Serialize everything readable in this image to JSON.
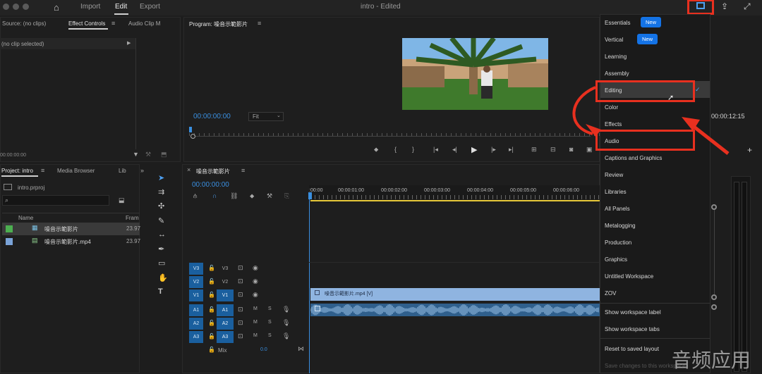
{
  "app": {
    "nav": {
      "import": "Import",
      "edit": "Edit",
      "export": "Export"
    },
    "title": "intro - Edited"
  },
  "source_panel": {
    "tabs": [
      "Source: (no clips)",
      "Effect Controls",
      "Audio Clip M"
    ],
    "no_clip": "(no clip selected)",
    "timecode": "00:00:00:00"
  },
  "program": {
    "title": "Program: 噪音示範影片",
    "timecode": "00:00:00:00",
    "fit": "Fit",
    "end_timecode": "00:00:12:15"
  },
  "project": {
    "tabs": [
      "Project: intro",
      "Media Browser",
      "Lib"
    ],
    "file": "intro.prproj",
    "columns": {
      "name": "Name",
      "frame": "Fram"
    },
    "items": [
      {
        "name": "噪音示範影片",
        "fps": "23.97",
        "color": "#4caf50"
      },
      {
        "name": "噪音示範影片.mp4",
        "fps": "23.97",
        "color": "#7aa3d8"
      }
    ]
  },
  "timeline": {
    "sequence_name": "噪音示範影片",
    "timecode": "00:00:00:00",
    "ruler": [
      ":00:00",
      "00:00:01:00",
      "00:00:02:00",
      "00:00:03:00",
      "00:00:04:00",
      "00:00:05:00",
      "00:00:06:00"
    ],
    "video_tracks": [
      {
        "patch": "V3",
        "name": "V3"
      },
      {
        "patch": "V2",
        "name": "V2"
      },
      {
        "patch": "V1",
        "name": "V1"
      }
    ],
    "audio_tracks": [
      {
        "patch": "A1",
        "name": "A1"
      },
      {
        "patch": "A2",
        "name": "A2"
      },
      {
        "patch": "A3",
        "name": "A3"
      }
    ],
    "mix_label": "Mix",
    "mix_value": "0.0",
    "clip_label": "噪音示範影片.mp4 [V]",
    "ms_labels": {
      "m": "M",
      "s": "S"
    }
  },
  "workspace_menu": {
    "items": [
      {
        "label": "Essentials",
        "badge": "New"
      },
      {
        "label": "Vertical",
        "badge": "New"
      },
      {
        "label": "Learning"
      },
      {
        "label": "Assembly"
      },
      {
        "label": "Editing",
        "checked": true
      },
      {
        "label": "Color"
      },
      {
        "label": "Effects"
      },
      {
        "label": "Audio"
      },
      {
        "label": "Captions and Graphics"
      },
      {
        "label": "Review"
      },
      {
        "label": "Libraries"
      },
      {
        "label": "All Panels"
      },
      {
        "label": "Metalogging"
      },
      {
        "label": "Production"
      },
      {
        "label": "Graphics"
      },
      {
        "label": "Untitled Workspace"
      },
      {
        "label": "ZOV"
      }
    ],
    "show_label": "Show workspace label",
    "show_tabs": "Show workspace tabs",
    "reset": "Reset to saved layout",
    "save": "Save changes to this workspace"
  },
  "watermark": "音频应用",
  "colors": {
    "accent": "#1473e6",
    "highlight": "#e8301f",
    "track": "#1a5f9e",
    "clip": "#8fb4e0"
  }
}
